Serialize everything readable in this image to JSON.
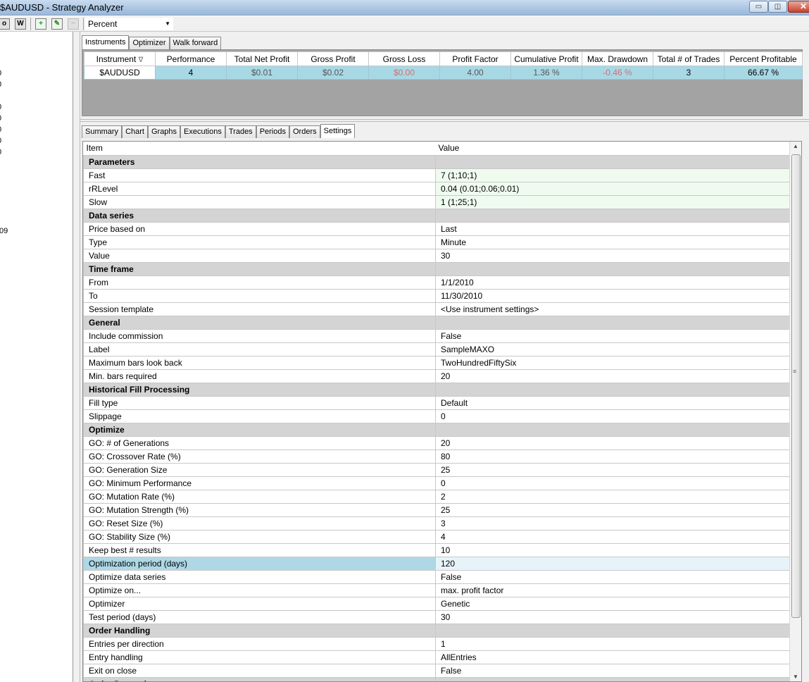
{
  "window": {
    "title": "$AUDUSD - Strategy Analyzer"
  },
  "toolbar": {
    "btn_o": "o",
    "btn_w": "W",
    "display_select": "Percent"
  },
  "left_panel": {
    "values": [
      "0",
      "0",
      "0",
      "0",
      "0",
      "0",
      "0",
      "09"
    ]
  },
  "top_tabs": [
    "Instruments",
    "Optimizer",
    "Walk forward"
  ],
  "instruments": {
    "headers": [
      "Instrument",
      "Performance",
      "Total Net Profit",
      "Gross Profit",
      "Gross Loss",
      "Profit Factor",
      "Cumulative Profit",
      "Max. Drawdown",
      "Total # of Trades",
      "Percent Profitable"
    ],
    "sort_indicator": "∇",
    "row": [
      "$AUDUSD",
      "4",
      "$0.01",
      "$0.02",
      "$0.00",
      "4.00",
      "1.36 %",
      "-0.46 %",
      "3",
      "66.67 %"
    ]
  },
  "bottom_tabs": [
    "Summary",
    "Chart",
    "Graphs",
    "Executions",
    "Trades",
    "Periods",
    "Orders",
    "Settings"
  ],
  "settings": {
    "header_item": "Item",
    "header_value": "Value",
    "rows": [
      {
        "type": "cat",
        "key": "Parameters",
        "value": ""
      },
      {
        "type": "param",
        "key": "Fast",
        "value": "7 (1;10;1)"
      },
      {
        "type": "param",
        "key": "rRLevel",
        "value": "0.04 (0.01;0.06;0.01)"
      },
      {
        "type": "param",
        "key": "Slow",
        "value": "1 (1;25;1)"
      },
      {
        "type": "cat",
        "key": "Data series",
        "value": ""
      },
      {
        "type": "row",
        "key": "Price based on",
        "value": "Last"
      },
      {
        "type": "row",
        "key": "Type",
        "value": "Minute"
      },
      {
        "type": "row",
        "key": "Value",
        "value": "30"
      },
      {
        "type": "cat",
        "key": "Time frame",
        "value": ""
      },
      {
        "type": "row",
        "key": "From",
        "value": "1/1/2010"
      },
      {
        "type": "row",
        "key": "To",
        "value": "11/30/2010"
      },
      {
        "type": "row",
        "key": "Session template",
        "value": "<Use instrument settings>"
      },
      {
        "type": "cat",
        "key": "General",
        "value": ""
      },
      {
        "type": "row",
        "key": "Include commission",
        "value": "False"
      },
      {
        "type": "row",
        "key": "Label",
        "value": "SampleMAXO"
      },
      {
        "type": "row",
        "key": "Maximum bars look back",
        "value": "TwoHundredFiftySix"
      },
      {
        "type": "row",
        "key": "Min. bars required",
        "value": "20"
      },
      {
        "type": "cat",
        "key": "Historical Fill Processing",
        "value": ""
      },
      {
        "type": "row",
        "key": "Fill type",
        "value": "Default"
      },
      {
        "type": "row",
        "key": "Slippage",
        "value": "0"
      },
      {
        "type": "cat",
        "key": "Optimize",
        "value": ""
      },
      {
        "type": "row",
        "key": "GO: # of Generations",
        "value": "20"
      },
      {
        "type": "row",
        "key": "GO: Crossover Rate (%)",
        "value": "80"
      },
      {
        "type": "row",
        "key": "GO: Generation Size",
        "value": "25"
      },
      {
        "type": "row",
        "key": "GO: Minimum Performance",
        "value": "0"
      },
      {
        "type": "row",
        "key": "GO: Mutation Rate (%)",
        "value": "2"
      },
      {
        "type": "row",
        "key": "GO: Mutation Strength (%)",
        "value": "25"
      },
      {
        "type": "row",
        "key": "GO: Reset Size (%)",
        "value": "3"
      },
      {
        "type": "row",
        "key": "GO: Stability Size (%)",
        "value": "4"
      },
      {
        "type": "row",
        "key": "Keep best # results",
        "value": "10"
      },
      {
        "type": "sel",
        "key": "Optimization period (days)",
        "value": "120"
      },
      {
        "type": "row",
        "key": "Optimize data series",
        "value": "False"
      },
      {
        "type": "row",
        "key": "Optimize on...",
        "value": "max. profit factor"
      },
      {
        "type": "row",
        "key": "Optimizer",
        "value": "Genetic"
      },
      {
        "type": "row",
        "key": "Test period (days)",
        "value": "30"
      },
      {
        "type": "cat",
        "key": "Order Handling",
        "value": ""
      },
      {
        "type": "row",
        "key": "Entries per direction",
        "value": "1"
      },
      {
        "type": "row",
        "key": "Entry handling",
        "value": "AllEntries"
      },
      {
        "type": "row",
        "key": "Exit on close",
        "value": "False"
      },
      {
        "type": "cat",
        "key": "Order Properties",
        "value": ""
      }
    ]
  }
}
